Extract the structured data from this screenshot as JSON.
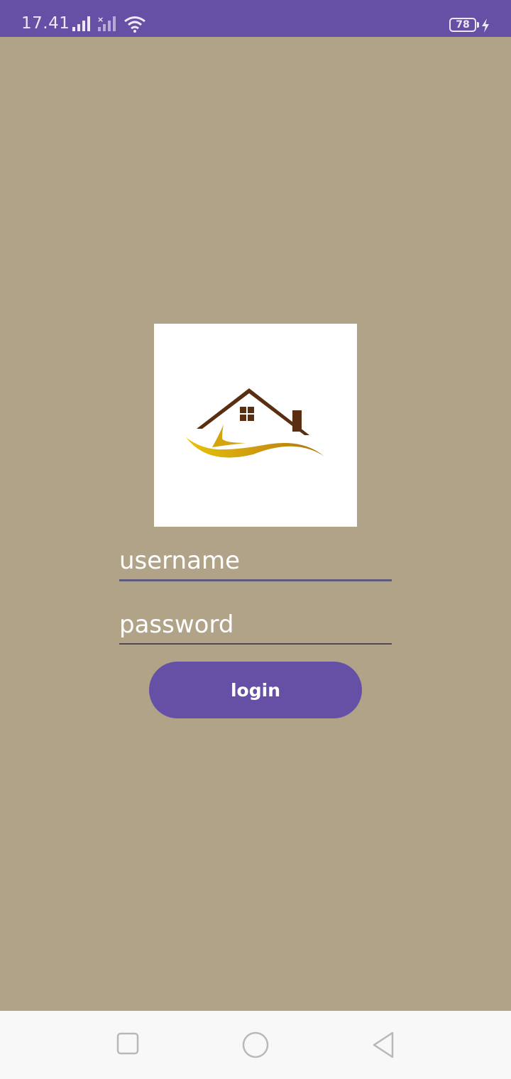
{
  "status_bar": {
    "time": "17.41",
    "battery_level": "78",
    "icons": [
      "signal-icon",
      "signal-no-service-icon",
      "wifi-icon",
      "battery-icon",
      "charging-bolt-icon"
    ],
    "background_color": "#6650a6"
  },
  "logo": {
    "icon": "house-logo-icon",
    "roof_color": "#5a2e10",
    "swoosh_color": "#d4a40c"
  },
  "form": {
    "username_placeholder": "username",
    "password_placeholder": "password",
    "login_label": "login"
  },
  "colors": {
    "background": "#b0a388",
    "accent": "#6650a6"
  },
  "nav_bar": {
    "buttons": [
      "recents-square-icon",
      "home-circle-icon",
      "back-triangle-icon"
    ]
  }
}
